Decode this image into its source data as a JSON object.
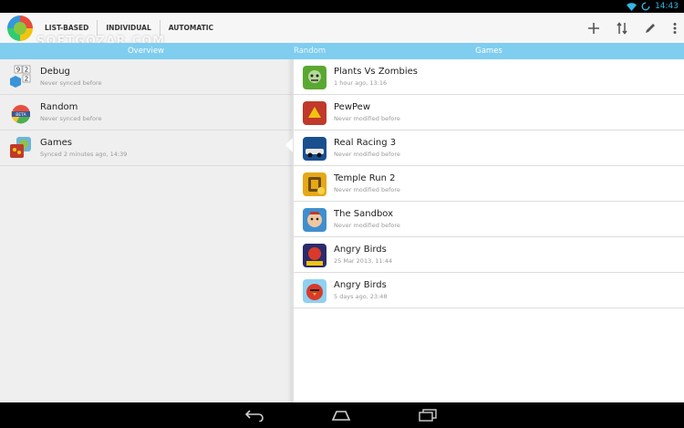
{
  "status_bar": {
    "time": "14:43"
  },
  "action_bar": {
    "tabs": [
      "LIST-BASED",
      "INDIVIDUAL",
      "AUTOMATIC"
    ],
    "watermark": "SOFTGOZAR.COM",
    "actions": [
      "add-icon",
      "sort-icon",
      "edit-icon",
      "overflow-menu-icon"
    ]
  },
  "header": {
    "left_title": "Overview",
    "crumb": "Random",
    "right_title": "Games"
  },
  "profiles": [
    {
      "name": "Debug",
      "status": "Never synced before",
      "icon": "debug-icon"
    },
    {
      "name": "Random",
      "status": "Never synced before",
      "icon": "random-icon"
    },
    {
      "name": "Games",
      "status": "Synced 2 minutes ago, 14:39",
      "icon": "games-icon"
    }
  ],
  "games": [
    {
      "name": "Plants Vs Zombies",
      "status": "1 hour ago, 13:16",
      "color": "#5aa832"
    },
    {
      "name": "PewPew",
      "status": "Never modified before",
      "color": "#c0392b"
    },
    {
      "name": "Real Racing 3",
      "status": "Never modified before",
      "color": "#1a4f8f"
    },
    {
      "name": "Temple Run 2",
      "status": "Never modified before",
      "color": "#e6a817"
    },
    {
      "name": "The Sandbox",
      "status": "Never modified before",
      "color": "#3f8fcf"
    },
    {
      "name": "Angry Birds",
      "status": "25 Mar 2013, 11:44",
      "color": "#2b2b6b"
    },
    {
      "name": "Angry Birds",
      "status": "5 days ago, 23:48",
      "color": "#d93a2b"
    }
  ]
}
